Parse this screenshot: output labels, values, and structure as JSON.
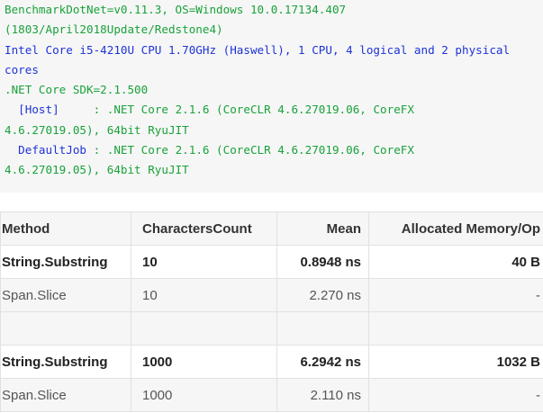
{
  "env": {
    "lines": [
      [
        {
          "text": "BenchmarkDotNet=v0.11.3, OS=Windows 10.0.17134.407",
          "color": "green"
        }
      ],
      [
        {
          "text": "(1803/April2018Update/Redstone4)",
          "color": "green"
        }
      ],
      [
        {
          "text": "Intel Core i5-4210U CPU 1.70GHz (Haswell), 1 CPU, 4 logical and 2 physical",
          "color": "blue"
        }
      ],
      [
        {
          "text": "cores",
          "color": "blue"
        }
      ],
      [
        {
          "text": ".NET Core SDK=2.1.500",
          "color": "green"
        }
      ],
      [
        {
          "text": "  [Host]",
          "color": "navy"
        },
        {
          "text": "     : .NET Core 2.1.6 (CoreCLR 4.6.27019.06, CoreFX",
          "color": "green"
        }
      ],
      [
        {
          "text": "4.6.27019.05), 64bit RyuJIT",
          "color": "green"
        }
      ],
      [
        {
          "text": "  DefaultJob",
          "color": "navy"
        },
        {
          "text": " : .NET Core 2.1.6 (CoreCLR 4.6.27019.06, CoreFX",
          "color": "green"
        }
      ],
      [
        {
          "text": "4.6.27019.05), 64bit RyuJIT",
          "color": "green"
        }
      ]
    ]
  },
  "table": {
    "headers": [
      "Method",
      "CharactersCount",
      "Mean",
      "Allocated Memory/Op"
    ],
    "rows": [
      {
        "style": "bold",
        "cells": [
          "String.Substring",
          "10",
          "0.8948 ns",
          "40 B"
        ]
      },
      {
        "style": "light",
        "cells": [
          "Span.Slice",
          "10",
          "2.270 ns",
          "-"
        ]
      },
      {
        "style": "empty",
        "cells": [
          "",
          "",
          "",
          ""
        ]
      },
      {
        "style": "bold",
        "cells": [
          "String.Substring",
          "1000",
          "6.2942 ns",
          "1032 B"
        ]
      },
      {
        "style": "light",
        "cells": [
          "Span.Slice",
          "1000",
          "2.110 ns",
          "-"
        ]
      }
    ]
  },
  "colors": {
    "green": "#19a23a",
    "blue": "#1e33d8",
    "navy": "#1e33d8",
    "code_bg": "#f6f6f6",
    "border": "#dfe2e5"
  }
}
